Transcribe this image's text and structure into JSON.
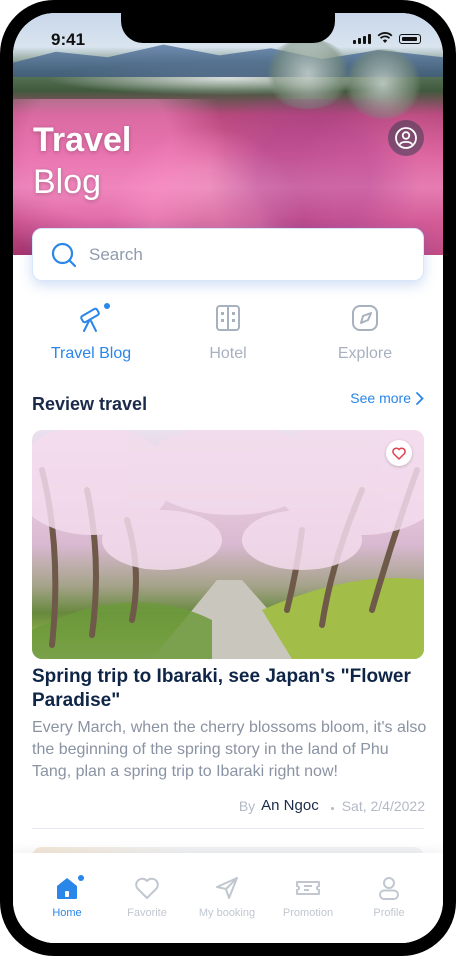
{
  "status_bar": {
    "time": "9:41"
  },
  "hero": {
    "title": "Travel",
    "subtitle": "Blog"
  },
  "search": {
    "placeholder": "Search"
  },
  "tabs": [
    {
      "label": "Travel Blog",
      "icon": "telescope-icon",
      "active": true
    },
    {
      "label": "Hotel",
      "icon": "building-icon",
      "active": false
    },
    {
      "label": "Explore",
      "icon": "compass-icon",
      "active": false
    }
  ],
  "section": {
    "title": "Review travel",
    "see_more": "See more"
  },
  "card": {
    "title": "Spring trip to Ibaraki, see Japan's \"Flower Paradise\"",
    "description": "Every March, when the cherry blossoms bloom, it's also the beginning of the spring story in the land of Phu Tang, plan a spring trip to Ibaraki right now!",
    "by_label": "By",
    "author": "An Ngoc",
    "date": "Sat, 2/4/2022"
  },
  "bottom_nav": [
    {
      "label": "Home",
      "icon": "home-icon",
      "active": true
    },
    {
      "label": "Favorite",
      "icon": "heart-icon",
      "active": false
    },
    {
      "label": "My booking",
      "icon": "paper-plane-icon",
      "active": false
    },
    {
      "label": "Promotion",
      "icon": "ticket-icon",
      "active": false
    },
    {
      "label": "Profile",
      "icon": "person-icon",
      "active": false
    }
  ],
  "colors": {
    "accent": "#2a86e8",
    "title_text": "#0f2547",
    "muted_text": "#8a93a3",
    "inactive": "#a7b1bf"
  }
}
